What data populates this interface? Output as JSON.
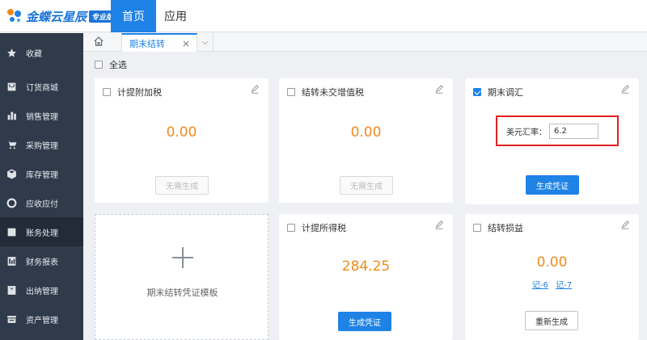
{
  "header": {
    "logo_text": "金蝶云星辰",
    "logo_badge": "专业版",
    "nav": [
      {
        "label": "首页",
        "active": true
      },
      {
        "label": "应用",
        "active": false
      }
    ]
  },
  "sidebar": {
    "items": [
      {
        "label": "收藏",
        "icon": "star-icon"
      },
      {
        "label": "订货商城",
        "icon": "shop-icon"
      },
      {
        "label": "销售管理",
        "icon": "bar-chart-icon"
      },
      {
        "label": "采购管理",
        "icon": "cart-icon"
      },
      {
        "label": "库存管理",
        "icon": "box-icon"
      },
      {
        "label": "应收应付",
        "icon": "coin-icon"
      },
      {
        "label": "账务处理",
        "icon": "ledger-icon",
        "active": true
      },
      {
        "label": "财务报表",
        "icon": "report-icon"
      },
      {
        "label": "出纳管理",
        "icon": "cashier-icon"
      },
      {
        "label": "资产管理",
        "icon": "asset-icon"
      }
    ]
  },
  "tabs": {
    "home_icon": "home-icon",
    "active_label": "期末结转",
    "close_glyph": "×",
    "more_glyph": "⌵"
  },
  "select_all": {
    "label": "全选",
    "checked": false
  },
  "cards": {
    "surcharge": {
      "title": "计提附加税",
      "checked": false,
      "value": "0.00",
      "button": "无需生成",
      "button_enabled": false
    },
    "vat": {
      "title": "结转未交增值税",
      "checked": false,
      "value": "0.00",
      "button": "无需生成",
      "button_enabled": false
    },
    "fx": {
      "title": "期末调汇",
      "checked": true,
      "rate_label": "美元汇率：",
      "rate_value": "6.2",
      "button": "生成凭证",
      "button_enabled": true
    },
    "income_tax": {
      "title": "计提所得税",
      "checked": false,
      "value": "284.25",
      "button": "生成凭证",
      "button_enabled": true
    },
    "pl": {
      "title": "结转损益",
      "checked": false,
      "value": "0.00",
      "links": [
        "记-6",
        "记-7"
      ],
      "button": "重新生成"
    }
  },
  "template": {
    "label": "期末结转凭证模板"
  },
  "colors": {
    "primary": "#1e82e6",
    "value": "#f08a1c",
    "sidebar": "#2f3a4a",
    "highlight_border": "#e02020"
  }
}
